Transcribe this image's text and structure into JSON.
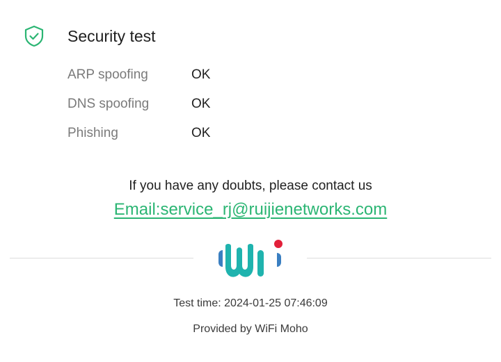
{
  "security": {
    "title": "Security test",
    "icon": "shield-check-icon",
    "accent_color": "#2bb573",
    "results": [
      {
        "name": "ARP spoofing",
        "status": "OK"
      },
      {
        "name": "DNS spoofing",
        "status": "OK"
      },
      {
        "name": "Phishing",
        "status": "OK"
      }
    ]
  },
  "contact": {
    "message": "If you have any doubts, please contact us",
    "email_label": "Email:service_rj@ruijienetworks.com",
    "link_color": "#2bb573"
  },
  "logo": {
    "icon": "wifi-moho-logo",
    "colors": {
      "teal": "#1fb3ae",
      "blue": "#3a7fc1",
      "red": "#e2203a"
    }
  },
  "footer": {
    "test_time": "Test time: 2024-01-25 07:46:09",
    "provided_by": "Provided by WiFi Moho"
  }
}
